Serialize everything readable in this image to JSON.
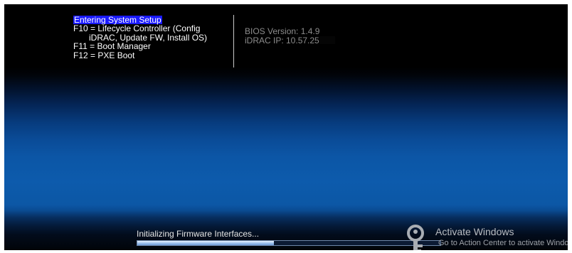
{
  "boot_menu": {
    "entering_setup": "Entering System Setup",
    "f10_line1": "F10 = Lifecycle Controller (Config",
    "f10_line2": "iDRAC, Update FW, Install OS)",
    "f11": "F11 = Boot Manager",
    "f12": "F12 = PXE Boot"
  },
  "system_info": {
    "bios_version": "BIOS Version: 1.4.9",
    "idrac_ip": "iDRAC IP:  10.57.25"
  },
  "status": {
    "text": "Initializing Firmware Interfaces...",
    "progress_fraction": 0.45
  },
  "watermark": {
    "title": "Activate Windows",
    "subtitle": "Go to Action Center to activate Windows.",
    "icon": "key-icon"
  },
  "colors": {
    "highlight": "#1a1aff",
    "info_text": "#8c8c8c",
    "background_blue": "#0c56a6"
  }
}
